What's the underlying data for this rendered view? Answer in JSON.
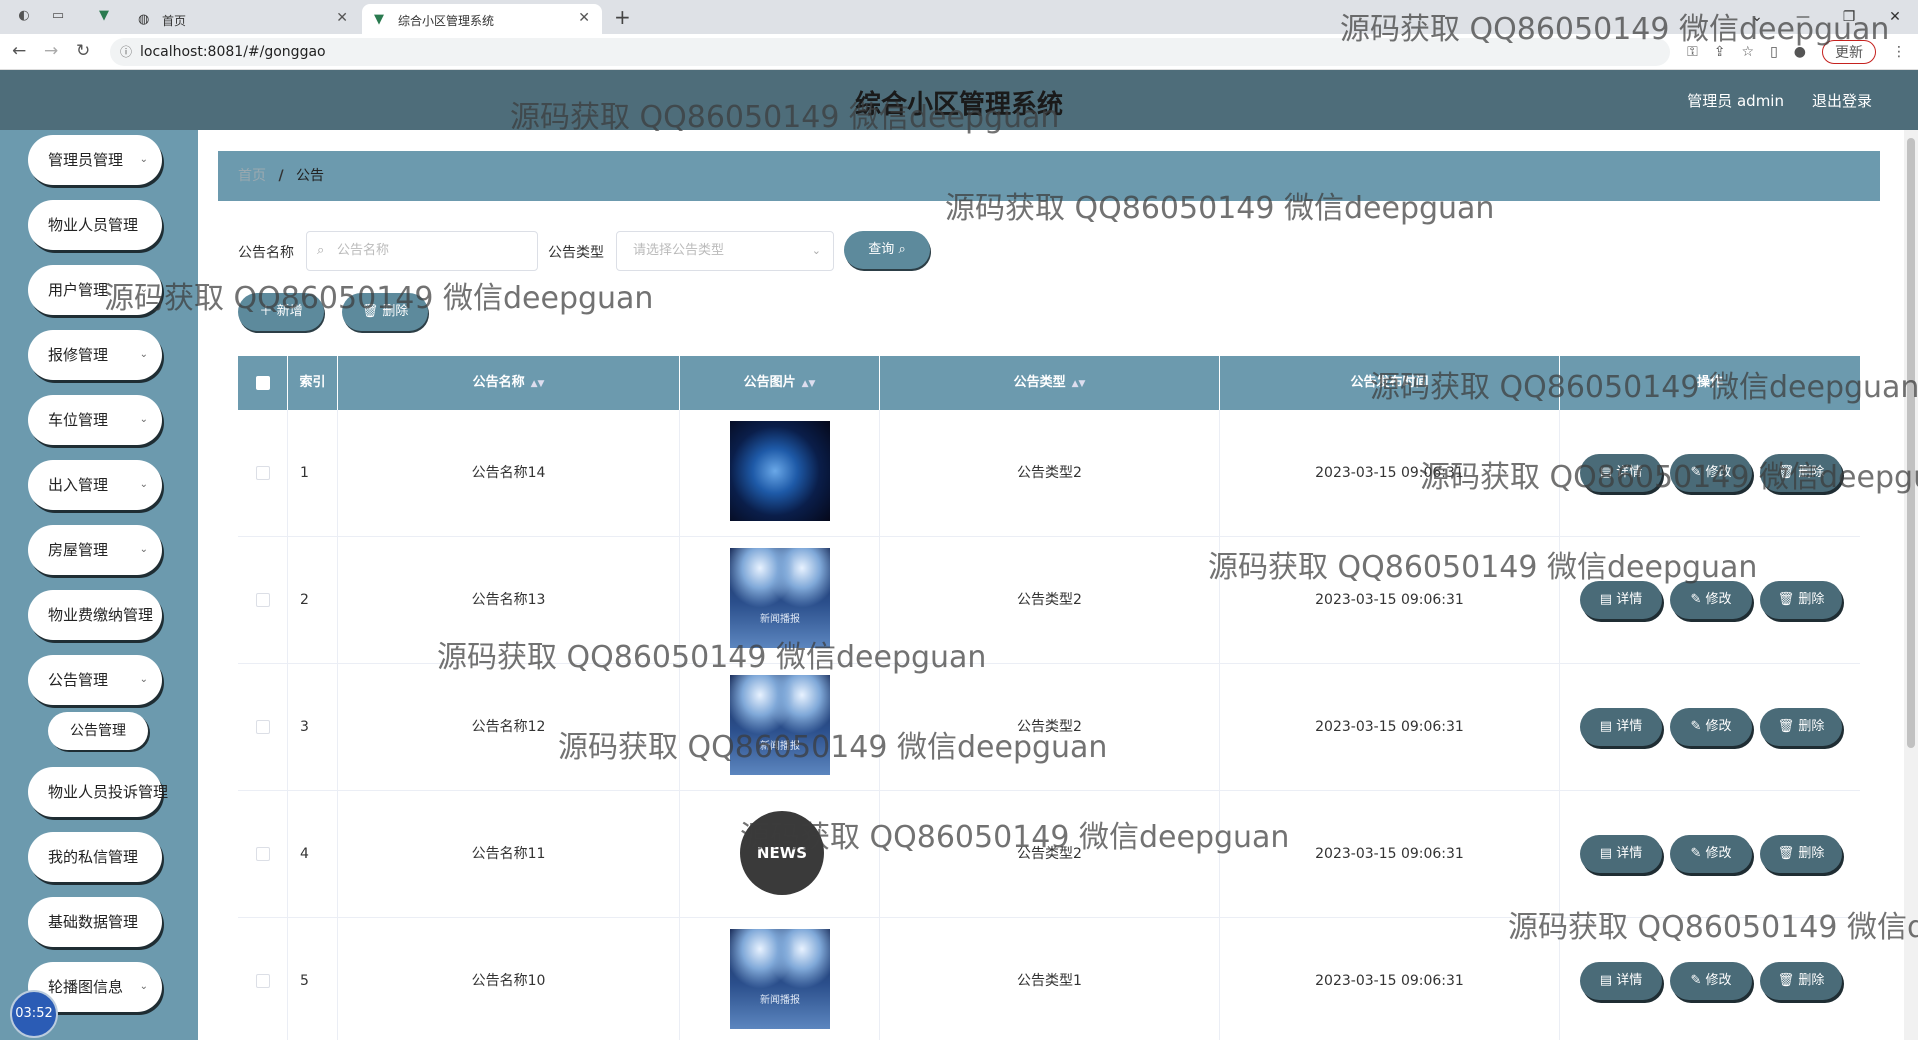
{
  "browser": {
    "tabs": [
      {
        "label": "首页",
        "active": false
      },
      {
        "label": "综合小区管理系统",
        "active": true
      }
    ],
    "url": "localhost:8081/#/gonggao",
    "update_label": "更新"
  },
  "header": {
    "title": "综合小区管理系统",
    "admin_label": "管理员 admin",
    "logout_label": "退出登录"
  },
  "sidebar": {
    "items": [
      {
        "label": "管理员管理",
        "has_chevron": true
      },
      {
        "label": "物业人员管理",
        "has_chevron": false
      },
      {
        "label": "用户管理",
        "has_chevron": true
      },
      {
        "label": "报修管理",
        "has_chevron": true
      },
      {
        "label": "车位管理",
        "has_chevron": true
      },
      {
        "label": "出入管理",
        "has_chevron": true
      },
      {
        "label": "房屋管理",
        "has_chevron": true
      },
      {
        "label": "物业费缴纳管理",
        "has_chevron": false
      },
      {
        "label": "公告管理",
        "has_chevron": true
      },
      {
        "label": "物业人员投诉管理",
        "has_chevron": false
      },
      {
        "label": "我的私信管理",
        "has_chevron": false
      },
      {
        "label": "基础数据管理",
        "has_chevron": false
      },
      {
        "label": "轮播图信息",
        "has_chevron": true
      }
    ],
    "submenu_label": "公告管理",
    "clock": "03:52"
  },
  "breadcrumb": {
    "home": "首页",
    "separator": "/",
    "current": "公告"
  },
  "search": {
    "name_label": "公告名称",
    "name_placeholder": "公告名称",
    "type_label": "公告类型",
    "type_placeholder": "请选择公告类型",
    "query_label": "查询"
  },
  "actions": {
    "add_label": "新增",
    "delete_label": "删除"
  },
  "table": {
    "headers": [
      "索引",
      "公告名称",
      "公告图片",
      "公告类型",
      "公告发布时间",
      "操作"
    ],
    "row_actions": {
      "detail": "详情",
      "edit": "修改",
      "delete": "删除"
    },
    "rows": [
      {
        "index": "1",
        "name": "公告名称14",
        "image": "globe",
        "type": "公告类型2",
        "time": "2023-03-15 09:06:31"
      },
      {
        "index": "2",
        "name": "公告名称13",
        "image": "stage",
        "type": "公告类型2",
        "time": "2023-03-15 09:06:31"
      },
      {
        "index": "3",
        "name": "公告名称12",
        "image": "stage",
        "type": "公告类型2",
        "time": "2023-03-15 09:06:31"
      },
      {
        "index": "4",
        "name": "公告名称11",
        "image": "news",
        "type": "公告类型2",
        "time": "2023-03-15 09:06:31"
      },
      {
        "index": "5",
        "name": "公告名称10",
        "image": "stage",
        "type": "公告类型1",
        "time": "2023-03-15 09:06:31"
      }
    ],
    "stage_caption": "新闻播报",
    "news_text": "NEWS"
  },
  "watermark": "源码获取 QQ86050149 微信deepguan",
  "colors": {
    "header": "#4e6d7a",
    "sidebar": "#6c9aae",
    "button": "#4a6b78"
  }
}
